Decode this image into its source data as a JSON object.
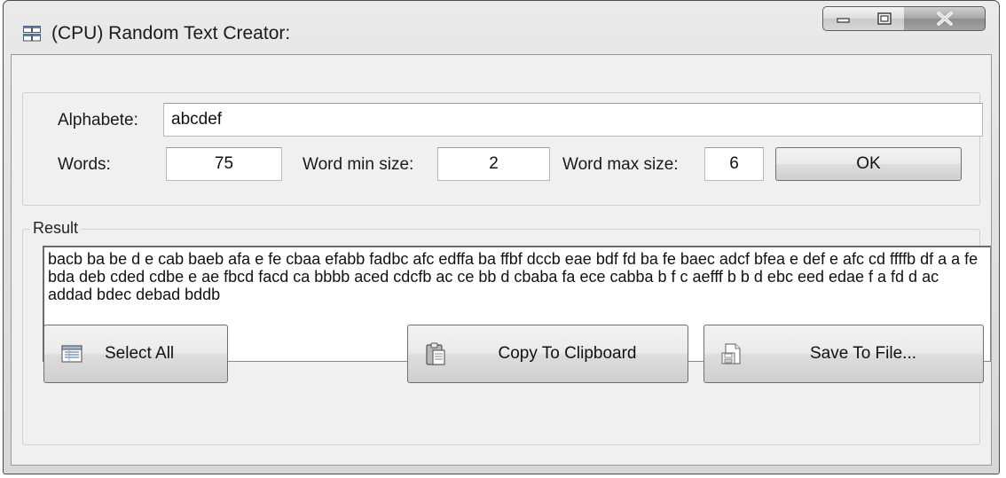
{
  "window": {
    "title": "(CPU) Random Text Creator:",
    "app_icon": "window-app-icon",
    "controls": {
      "minimize_icon": "minimize-icon",
      "maximize_icon": "maximize-icon",
      "close_icon": "close-icon"
    }
  },
  "settings": {
    "alphabet_label": "Alphabete:",
    "alphabet_value": "abcdef",
    "words_label": "Words:",
    "words_value": "75",
    "min_size_label": "Word min size:",
    "min_size_value": "2",
    "max_size_label": "Word max size:",
    "max_size_value": "6",
    "ok_label": "OK"
  },
  "result": {
    "group_label": "Result",
    "text": "bacb ba be d e cab baeb afa e fe cbaa efabb fadbc afc edffa ba ffbf dccb eae bdf fd ba fe baec adcf bfea e def e afc cd ffffb df a a fe bda deb cded cdbe e ae fbcd facd ca bbbb aced cdcfb ac ce bb d cbaba fa ece cabba b f c aefff b b d ebc eed edae f a fd d ac addad bdec debad bddb"
  },
  "actions": {
    "select_all_label": "Select All",
    "select_all_icon": "select-all-icon",
    "copy_label": "Copy To Clipboard",
    "copy_icon": "clipboard-icon",
    "save_label": "Save To File...",
    "save_icon": "save-file-icon"
  },
  "colors": {
    "window_bg": "#f0f0f0",
    "close_button": "#9a9a9a",
    "text": "#111111"
  }
}
